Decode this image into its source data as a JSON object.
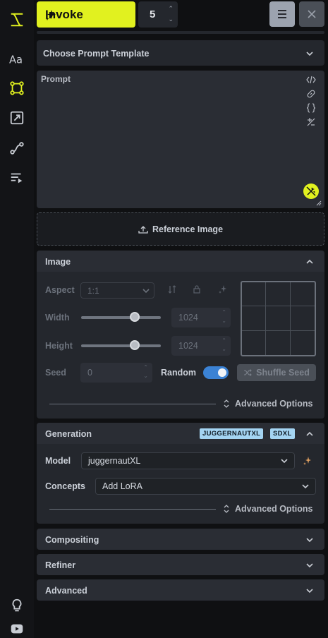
{
  "toolbar": {
    "invoke_label": "Invoke",
    "iterations_value": "5"
  },
  "prompt_template": {
    "label": "Choose Prompt Template"
  },
  "prompt": {
    "label": "Prompt"
  },
  "reference": {
    "label": "Reference Image"
  },
  "image_panel": {
    "title": "Image",
    "aspect_label": "Aspect",
    "aspect_value": "1:1",
    "width_label": "Width",
    "width_value": "1024",
    "width_fraction": 0.67,
    "height_label": "Height",
    "height_value": "1024",
    "height_fraction": 0.67,
    "seed_label": "Seed",
    "seed_value": "0",
    "random_label": "Random",
    "random_on": true,
    "shuffle_label": "Shuffle Seed",
    "advanced_label": "Advanced Options"
  },
  "generation_panel": {
    "title": "Generation",
    "badges": [
      "JUGGERNAUTXL",
      "SDXL"
    ],
    "model_label": "Model",
    "model_value": "juggernautXL",
    "concepts_label": "Concepts",
    "concepts_value": "Add LoRA",
    "advanced_label": "Advanced Options"
  },
  "collapsed_panels": [
    {
      "title": "Compositing"
    },
    {
      "title": "Refiner"
    },
    {
      "title": "Advanced"
    }
  ],
  "colors": {
    "accent": "#e1f11f",
    "toggle_on": "#3b82d4",
    "badge": "#a4d4f2",
    "background": "#0f1012",
    "panel": "#24272d"
  }
}
